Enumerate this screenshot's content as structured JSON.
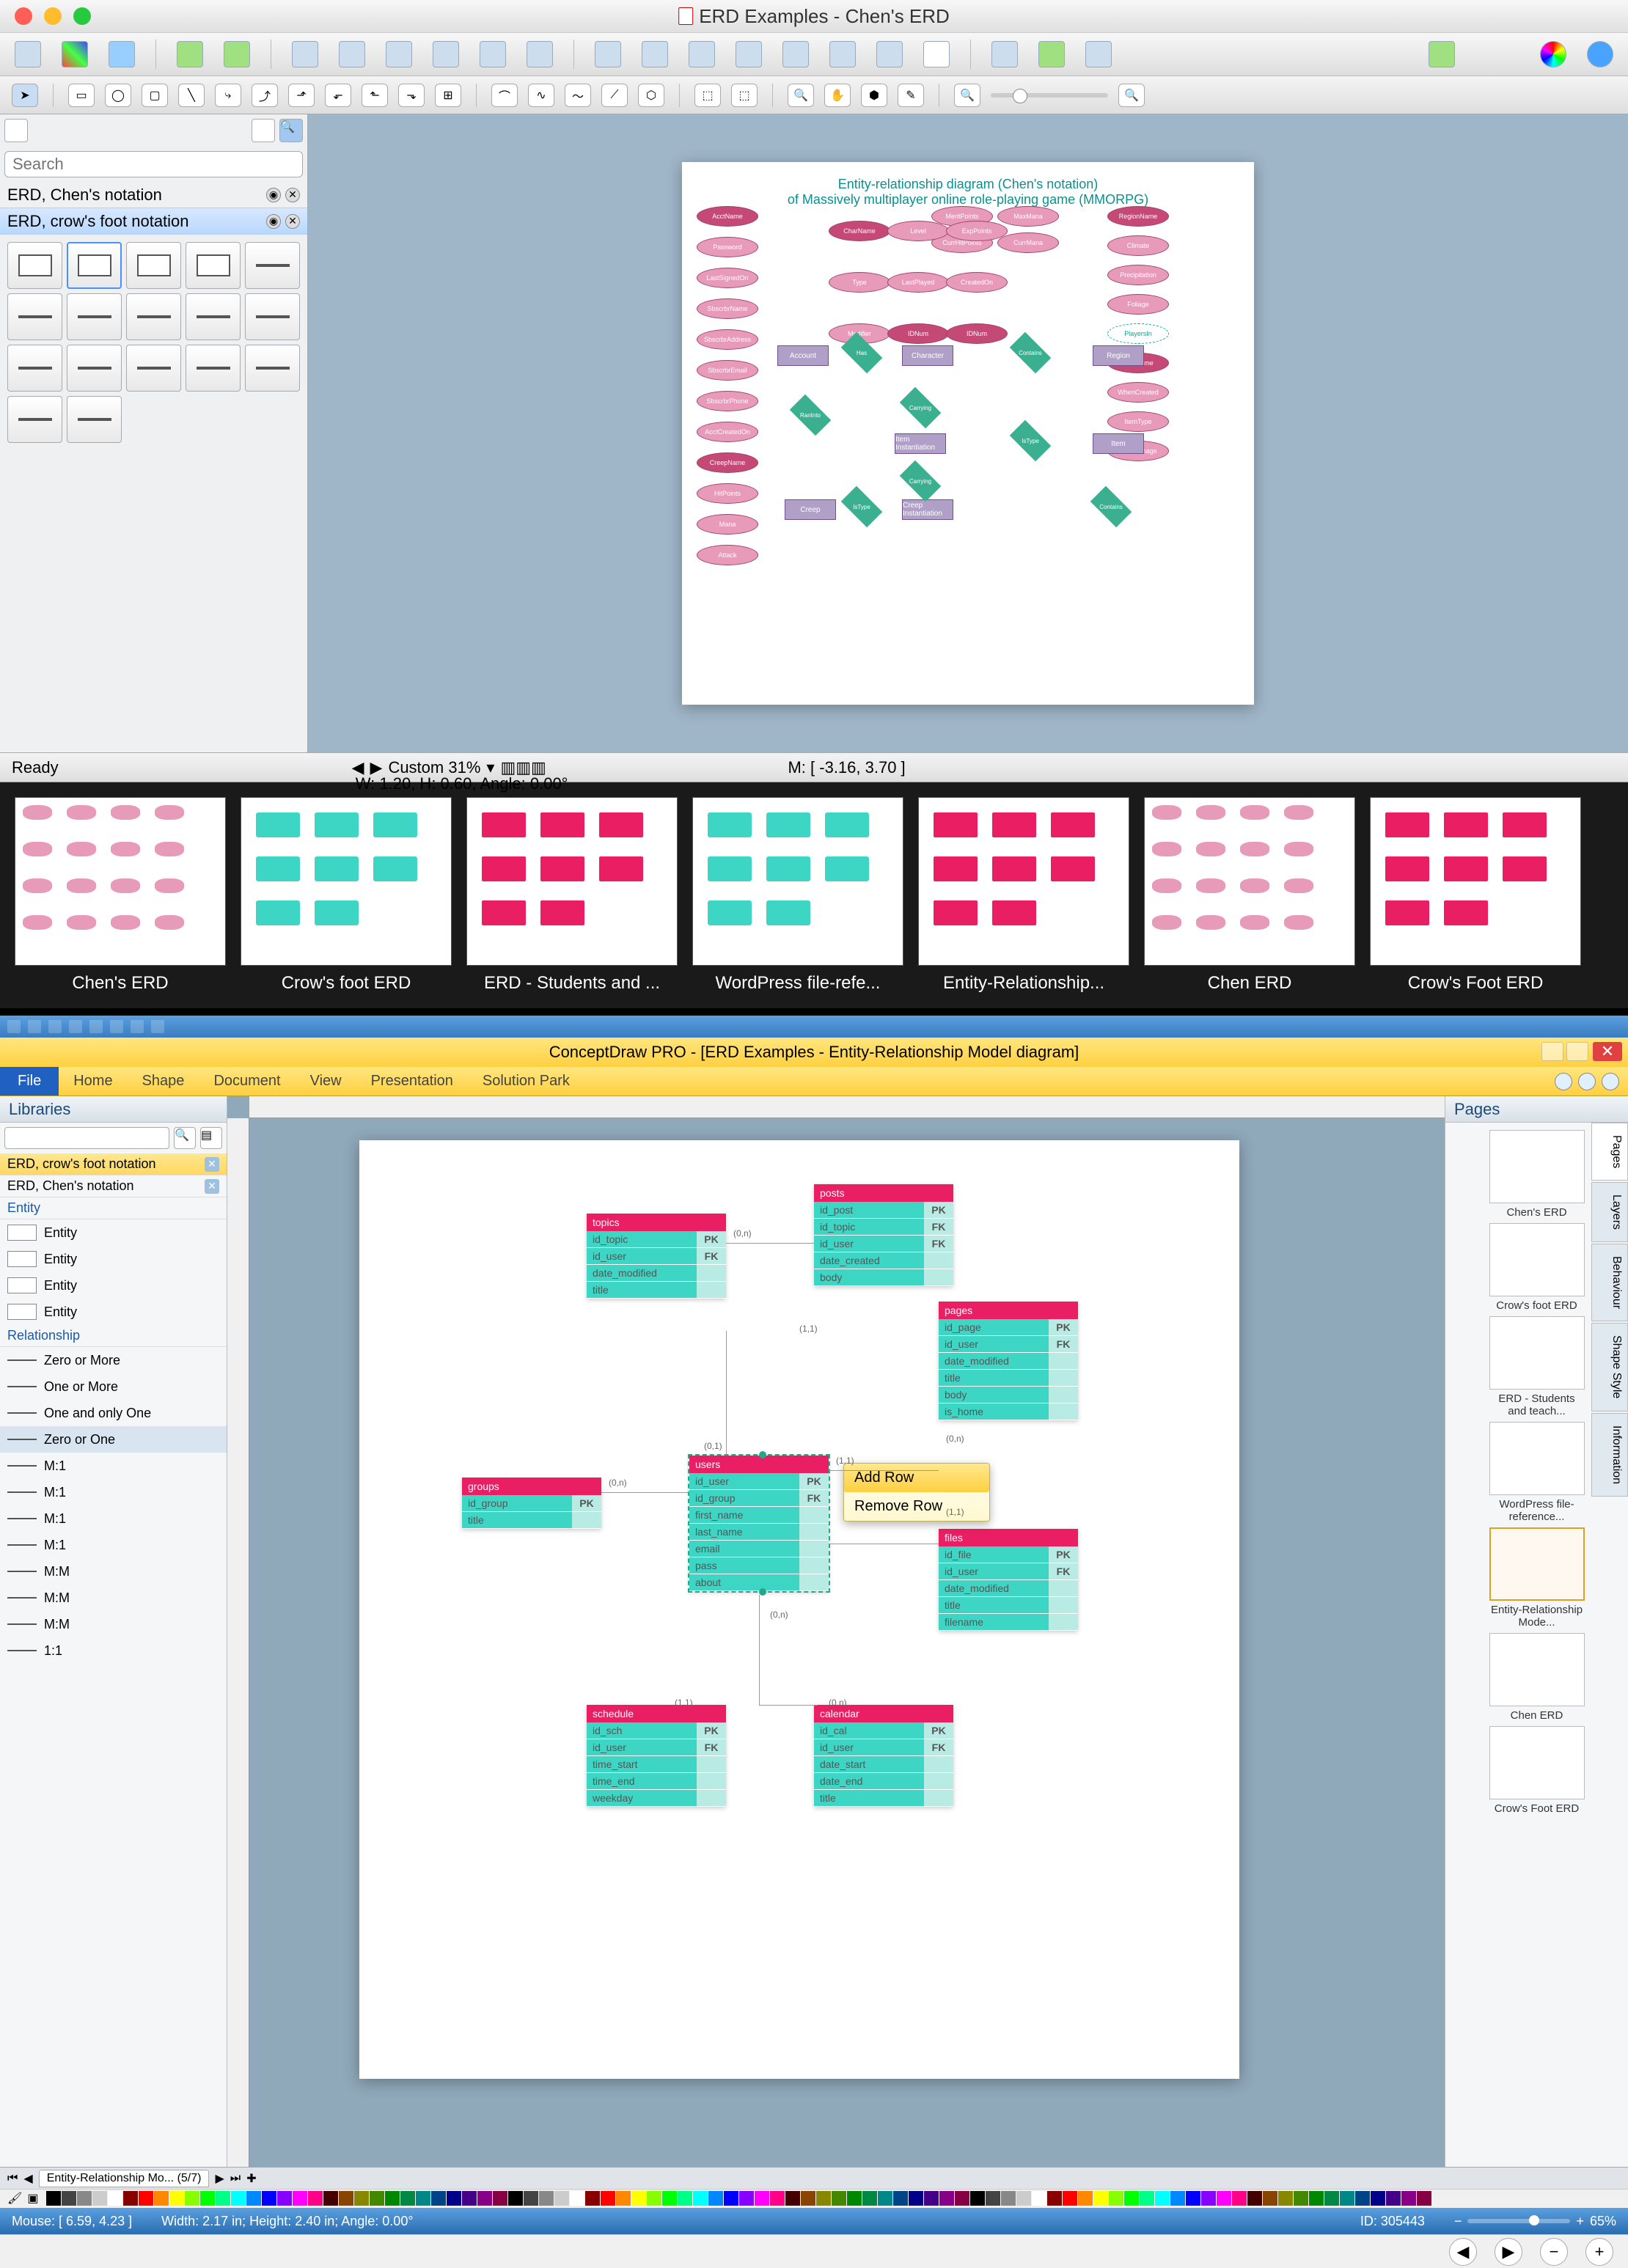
{
  "mac": {
    "title": "ERD Examples - Chen's ERD",
    "search_placeholder": "Search",
    "libs": [
      {
        "name": "ERD, Chen's notation",
        "selected": false
      },
      {
        "name": "ERD, crow's foot notation",
        "selected": true
      }
    ],
    "zoom_label": "Custom 31%",
    "status_ready": "Ready",
    "status_dims": "W: 1.20,  H: 0.60,  Angle: 0.00°",
    "status_mouse": "M: [ -3.16, 3.70 ]",
    "erd": {
      "title1": "Entity-relationship diagram (Chen's notation)",
      "title2": "of Massively multiplayer online role-playing game (MMORPG)",
      "attrs_left": [
        "AcctName",
        "Password",
        "LastSignedOn",
        "SbscrbrName",
        "SbscrbrAddress",
        "SbscrbrEmail",
        "SbscrbrPhone",
        "AcctCreatedOn",
        "CreepName",
        "HitPoints",
        "Mana",
        "Attack"
      ],
      "attrs_mid": [
        "CharName",
        "Level",
        "ExpPoints",
        "Type",
        "LastPlayed",
        "CreatedOn",
        "Modifier",
        "IDNum",
        "IDNum"
      ],
      "attrs_top": [
        "MeritPoints",
        "MaxMana",
        "CurrHitPoints",
        "CurrMana"
      ],
      "attrs_right": [
        "RegionName",
        "Climate",
        "Precipitation",
        "Foliage",
        "PlayersIn",
        "ItemName",
        "WhenCreated",
        "ItemType",
        "ItemDamage"
      ],
      "entities": [
        "Account",
        "Character",
        "Region",
        "Creep",
        "Item",
        "Item Instantiation",
        "Creep Instantiation"
      ],
      "rels": [
        "Has",
        "Contains",
        "RanInto",
        "Carrying",
        "IsType",
        "Carrying",
        "IsType",
        "Contains"
      ]
    }
  },
  "thumbs": [
    "Chen's ERD",
    "Crow's foot ERD",
    "ERD - Students and ...",
    "WordPress file-refe...",
    "Entity-Relationship...",
    "Chen ERD",
    "Crow's Foot ERD"
  ],
  "win": {
    "title": "ConceptDraw PRO - [ERD Examples - Entity-Relationship Model diagram]",
    "file_tab": "File",
    "ribbon_tabs": [
      "Home",
      "Shape",
      "Document",
      "View",
      "Presentation",
      "Solution Park"
    ],
    "left_panel": "Libraries",
    "right_panel": "Pages",
    "libs": [
      {
        "name": "ERD, crow's foot notation",
        "active": true
      },
      {
        "name": "ERD, Chen's notation",
        "active": false
      }
    ],
    "cat_entity": "Entity",
    "cat_rel": "Relationship",
    "entity_items": [
      "Entity",
      "Entity",
      "Entity",
      "Entity"
    ],
    "rel_items": [
      "Zero or More",
      "One or More",
      "One and only One",
      "Zero or One",
      "M:1",
      "M:1",
      "M:1",
      "M:1",
      "M:M",
      "M:M",
      "M:M",
      "1:1"
    ],
    "rel_selected": "Zero or One",
    "ctx_menu": [
      "Add Row",
      "Remove Row"
    ],
    "tables": {
      "topics": {
        "name": "topics",
        "rows": [
          [
            "id_topic",
            "PK"
          ],
          [
            "id_user",
            "FK"
          ],
          [
            "date_modified",
            ""
          ],
          [
            "title",
            ""
          ]
        ]
      },
      "posts": {
        "name": "posts",
        "rows": [
          [
            "id_post",
            "PK"
          ],
          [
            "id_topic",
            "FK"
          ],
          [
            "id_user",
            "FK"
          ],
          [
            "date_created",
            ""
          ],
          [
            "body",
            ""
          ]
        ]
      },
      "pages": {
        "name": "pages",
        "rows": [
          [
            "id_page",
            "PK"
          ],
          [
            "id_user",
            "FK"
          ],
          [
            "date_modified",
            ""
          ],
          [
            "title",
            ""
          ],
          [
            "body",
            ""
          ],
          [
            "is_home",
            ""
          ]
        ]
      },
      "users": {
        "name": "users",
        "rows": [
          [
            "id_user",
            "PK"
          ],
          [
            "id_group",
            "FK"
          ],
          [
            "first_name",
            ""
          ],
          [
            "last_name",
            ""
          ],
          [
            "email",
            ""
          ],
          [
            "pass",
            ""
          ],
          [
            "about",
            ""
          ]
        ]
      },
      "groups": {
        "name": "groups",
        "rows": [
          [
            "id_group",
            "PK"
          ],
          [
            "title",
            ""
          ]
        ]
      },
      "files": {
        "name": "files",
        "rows": [
          [
            "id_file",
            "PK"
          ],
          [
            "id_user",
            "FK"
          ],
          [
            "date_modified",
            ""
          ],
          [
            "title",
            ""
          ],
          [
            "filename",
            ""
          ]
        ]
      },
      "schedule": {
        "name": "schedule",
        "rows": [
          [
            "id_sch",
            "PK"
          ],
          [
            "id_user",
            "FK"
          ],
          [
            "time_start",
            ""
          ],
          [
            "time_end",
            ""
          ],
          [
            "weekday",
            ""
          ]
        ]
      },
      "calendar": {
        "name": "calendar",
        "rows": [
          [
            "id_cal",
            "PK"
          ],
          [
            "id_user",
            "FK"
          ],
          [
            "date_start",
            ""
          ],
          [
            "date_end",
            ""
          ],
          [
            "title",
            ""
          ]
        ]
      }
    },
    "cardinalities": [
      "(0,n)",
      "(1,1)",
      "(0,1)",
      "(0,n)",
      "(1,1)",
      "(0,n)",
      "(1,1)",
      "(0,n)",
      "(1,1)",
      "(0,n)"
    ],
    "page_thumbs": [
      "Chen's ERD",
      "Crow's foot ERD",
      "ERD - Students and teach...",
      "WordPress file-reference...",
      "Entity-Relationship Mode...",
      "Chen ERD",
      "Crow's Foot ERD"
    ],
    "page_tab": "Entity-Relationship Mo...  (5/7)",
    "vtabs": [
      "Pages",
      "Layers",
      "Behaviour",
      "Shape Style",
      "Information"
    ],
    "status": {
      "mouse": "Mouse: [ 6.59, 4.23 ]",
      "dims": "Width: 2.17 in;  Height: 2.40 in;  Angle: 0.00°",
      "id": "ID: 305443",
      "zoom": "65%"
    }
  },
  "colors": [
    "#000",
    "#444",
    "#888",
    "#ccc",
    "#fff",
    "#800",
    "#f00",
    "#f80",
    "#ff0",
    "#8f0",
    "#0f0",
    "#0f8",
    "#0ff",
    "#08f",
    "#00f",
    "#80f",
    "#f0f",
    "#f08",
    "#400",
    "#840",
    "#880",
    "#480",
    "#080",
    "#084",
    "#088",
    "#048",
    "#008",
    "#408",
    "#808",
    "#804"
  ]
}
